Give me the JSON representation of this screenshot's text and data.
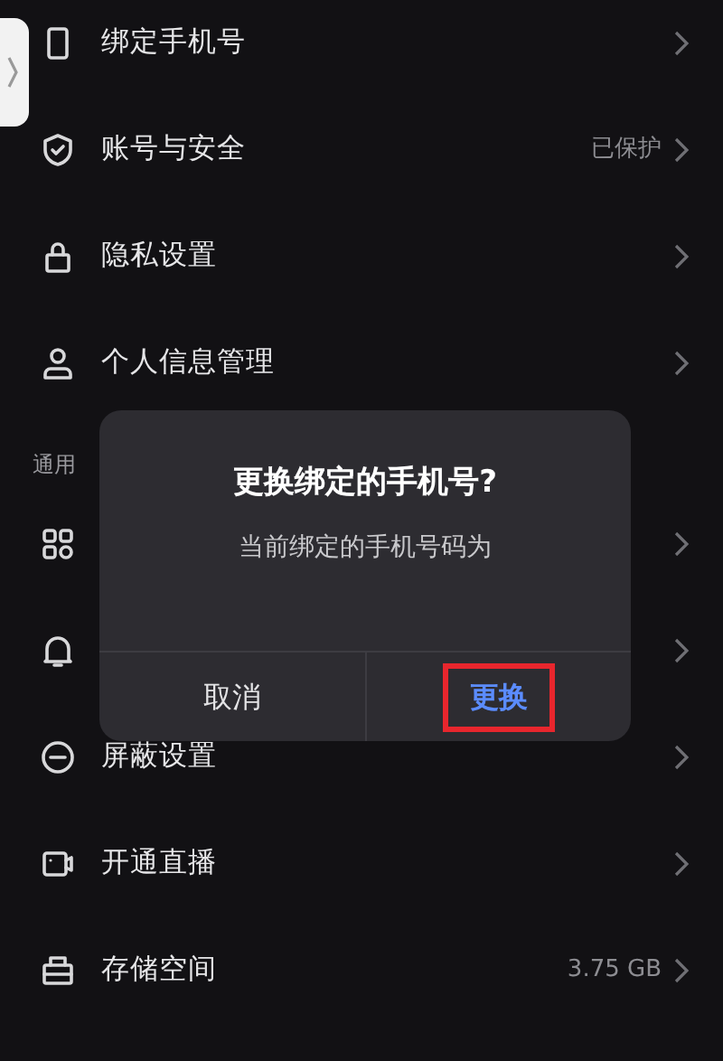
{
  "settings": [
    {
      "kind": "row",
      "label": "绑定手机号"
    },
    {
      "kind": "row",
      "label": "账号与安全",
      "value": "已保护"
    },
    {
      "kind": "row",
      "label": "隐私设置"
    },
    {
      "kind": "row",
      "label": "个人信息管理"
    },
    {
      "kind": "section",
      "label": "通用"
    },
    {
      "kind": "row"
    },
    {
      "kind": "row"
    },
    {
      "kind": "row",
      "label": "屏蔽设置"
    },
    {
      "kind": "row",
      "label": "开通直播"
    },
    {
      "kind": "row",
      "label": "存储空间",
      "value": "3.75 GB"
    }
  ],
  "dialog": {
    "title": "更换绑定的手机号?",
    "message": "当前绑定的手机号码为",
    "buttons": [
      {
        "label": "取消",
        "primary": false,
        "highlighted": false
      },
      {
        "label": "更换",
        "primary": true,
        "highlighted": true
      }
    ]
  }
}
